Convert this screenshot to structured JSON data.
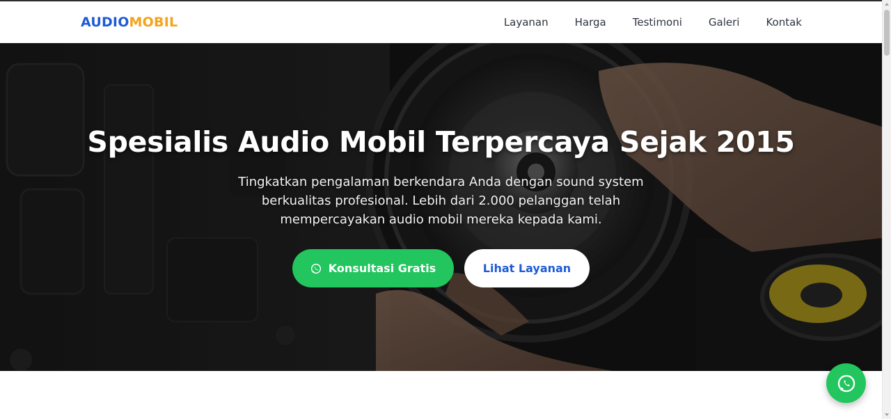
{
  "brand": {
    "part1": "AUDIO",
    "part2": "MOBIL",
    "color1": "#1e5bd6",
    "color2": "#f4a31b"
  },
  "nav": {
    "items": [
      {
        "label": "Layanan"
      },
      {
        "label": "Harga"
      },
      {
        "label": "Testimoni"
      },
      {
        "label": "Galeri"
      },
      {
        "label": "Kontak"
      }
    ]
  },
  "hero": {
    "title": "Spesialis Audio Mobil Terpercaya Sejak 2015",
    "subtitle": "Tingkatkan pengalaman berkendara Anda dengan sound system berkualitas profesional. Lebih dari 2.000 pelanggan telah mempercayakan audio mobil mereka kepada kami.",
    "primary_button": {
      "label": "Konsultasi Gratis",
      "icon": "whatsapp-icon"
    },
    "secondary_button": {
      "label": "Lihat Layanan"
    },
    "background": "speaker-photo"
  },
  "floating_button": {
    "icon": "whatsapp-icon"
  },
  "colors": {
    "accent_green": "#22c55e",
    "accent_blue": "#1e5bd6",
    "accent_orange": "#f4a31b"
  }
}
